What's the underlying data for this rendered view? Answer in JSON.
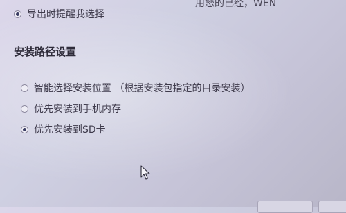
{
  "top_clipped_text": "用您的已经，WEN",
  "export_prompt": {
    "label": "导出时提醒我选择",
    "selected": true
  },
  "install_path_section": {
    "title": "安装路径设置",
    "options": [
      {
        "label": "智能选择安装位置  （根据安装包指定的目录安装）",
        "selected": false
      },
      {
        "label": "优先安装到手机内存",
        "selected": false
      },
      {
        "label": "优先安装到SD卡",
        "selected": true
      }
    ]
  },
  "icons": {
    "cursor": "mouse-pointer-icon"
  }
}
